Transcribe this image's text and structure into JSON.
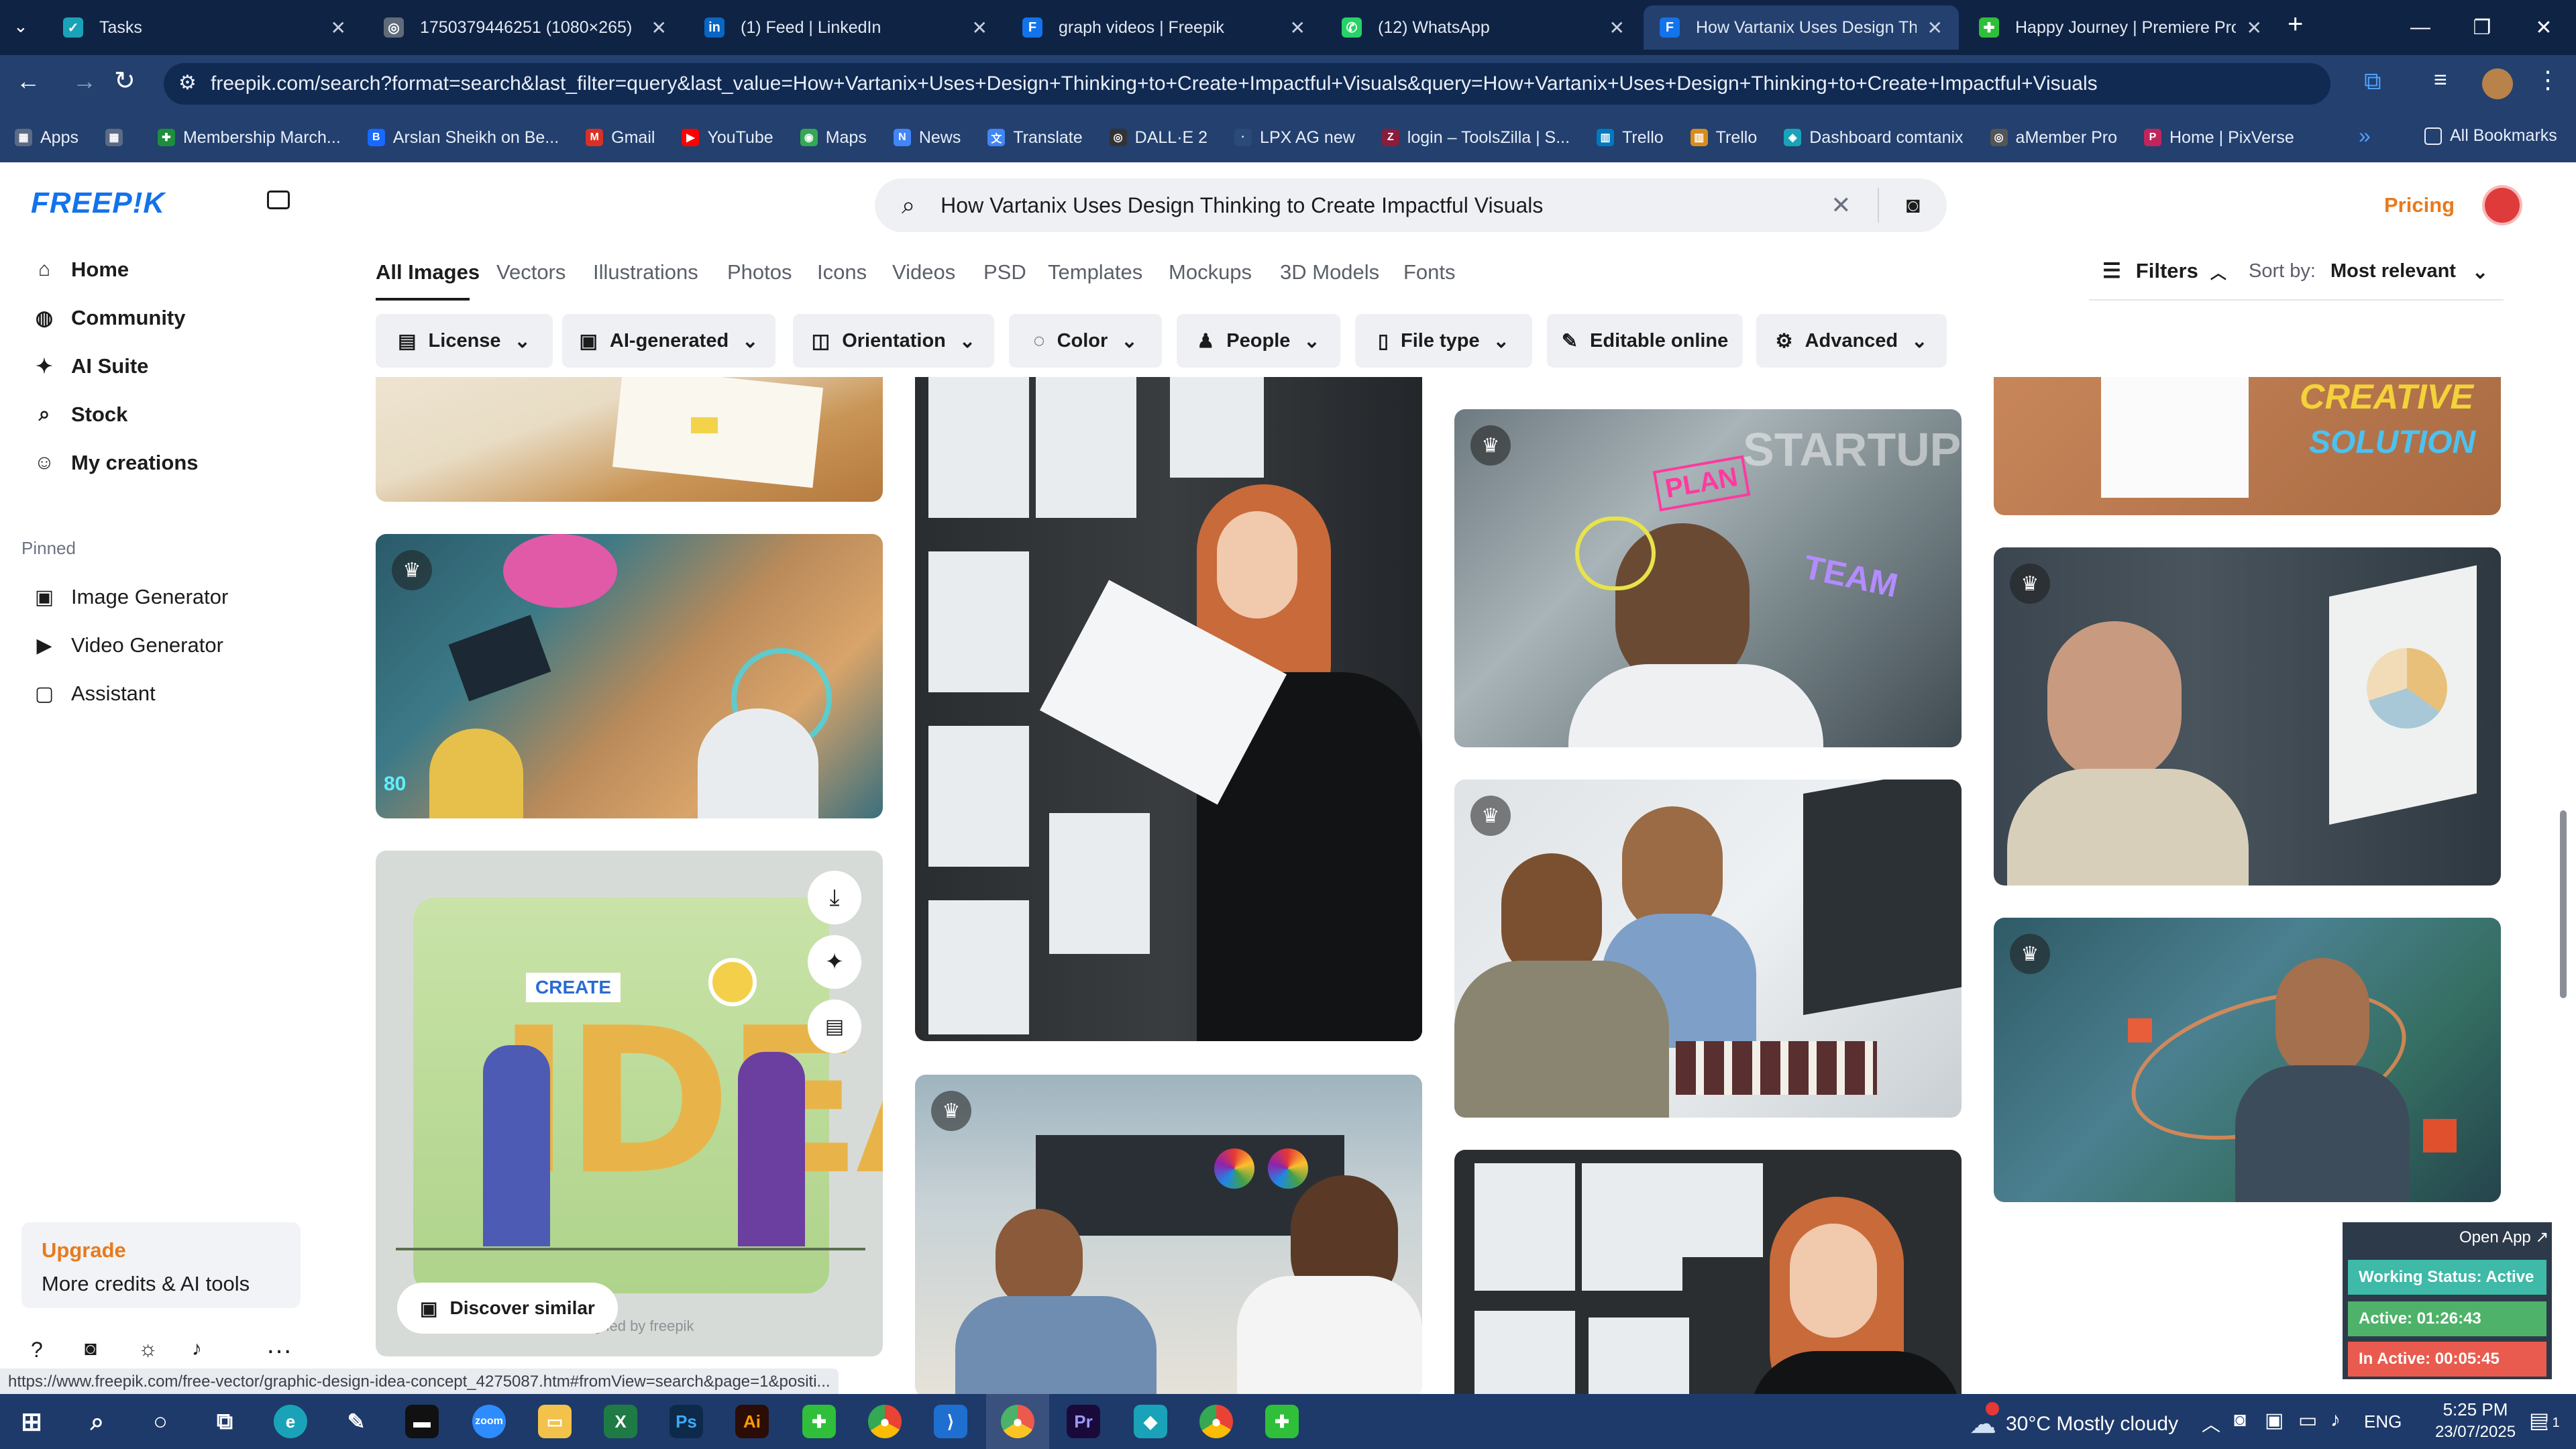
{
  "browser": {
    "tabs": [
      {
        "title": "Tasks",
        "color": "#1aa3b8",
        "glyph": "✓"
      },
      {
        "title": "1750379446251 (1080×265)",
        "color": "#5f6b7a",
        "glyph": "◎"
      },
      {
        "title": "(1) Feed | LinkedIn",
        "color": "#0a66c2",
        "glyph": "in"
      },
      {
        "title": "graph videos | Freepik",
        "color": "#1273eb",
        "glyph": "F"
      },
      {
        "title": "(12) WhatsApp",
        "color": "#25d366",
        "glyph": "✆"
      },
      {
        "title": "How Vartanix Uses Design Thin",
        "color": "#1273eb",
        "glyph": "F"
      },
      {
        "title": "Happy Journey | Premiere Pro I",
        "color": "#2fbf3a",
        "glyph": "✚"
      }
    ],
    "new_tab": "+",
    "url": "freepik.com/search?format=search&last_filter=query&last_value=How+Vartanix+Uses+Design+Thinking+to+Create+Impactful+Visuals&query=How+Vartanix+Uses+Design+Thinking+to+Create+Impactful+Visuals",
    "bookmarks": [
      {
        "label": "Apps",
        "color": "#5b6b86",
        "glyph": "▦"
      },
      {
        "label": "",
        "color": "#5b6b86",
        "glyph": "▦"
      },
      {
        "label": "Membership March...",
        "color": "#1e8e3e",
        "glyph": "✚"
      },
      {
        "label": "Arslan Sheikh on Be...",
        "color": "#1769ff",
        "glyph": "Bē"
      },
      {
        "label": "Gmail",
        "color": "#d93025",
        "glyph": "M"
      },
      {
        "label": "YouTube",
        "color": "#ff0000",
        "glyph": "▶"
      },
      {
        "label": "Maps",
        "color": "#34a853",
        "glyph": "◉"
      },
      {
        "label": "News",
        "color": "#4285f4",
        "glyph": "N"
      },
      {
        "label": "Translate",
        "color": "#4285f4",
        "glyph": "文"
      },
      {
        "label": "DALL·E 2",
        "color": "#333333",
        "glyph": "◎"
      },
      {
        "label": "LPX AG new",
        "color": "#2b4a7a",
        "glyph": "···"
      },
      {
        "label": "login – ToolsZilla | S...",
        "color": "#8a1c3c",
        "glyph": "Z"
      },
      {
        "label": "Trello",
        "color": "#0079bf",
        "glyph": "▥"
      },
      {
        "label": "Trello",
        "color": "#d98c1a",
        "glyph": "▥"
      },
      {
        "label": "Dashboard comtanix",
        "color": "#1aa3b8",
        "glyph": "◈"
      },
      {
        "label": "aMember Pro",
        "color": "#555555",
        "glyph": "◎"
      },
      {
        "label": "Home | PixVerse",
        "color": "#c2255c",
        "glyph": "P"
      }
    ],
    "all_bookmarks": "All Bookmarks"
  },
  "freepik": {
    "logo": "FREEP!K",
    "nav": [
      {
        "label": "Home",
        "icon": "home-icon",
        "glyph": "⌂"
      },
      {
        "label": "Community",
        "icon": "globe-icon",
        "glyph": "◍"
      },
      {
        "label": "AI Suite",
        "icon": "sparkle-icon",
        "glyph": "✦"
      },
      {
        "label": "Stock",
        "icon": "search-icon",
        "glyph": "⌕"
      },
      {
        "label": "My creations",
        "icon": "user-icon",
        "glyph": "☺"
      }
    ],
    "pinned_heading": "Pinned",
    "pinned": [
      {
        "label": "Image Generator",
        "icon": "image-icon",
        "glyph": "▣"
      },
      {
        "label": "Video Generator",
        "icon": "video-icon",
        "glyph": "▶"
      },
      {
        "label": "Assistant",
        "icon": "chat-icon",
        "glyph": "▢"
      }
    ],
    "upgrade": {
      "title": "Upgrade",
      "subtitle": "More credits & AI tools"
    },
    "search_query": "How Vartanix Uses Design Thinking to Create Impactful Visuals",
    "pricing": "Pricing",
    "categories": [
      "All Images",
      "Vectors",
      "Illustrations",
      "Photos",
      "Icons",
      "Videos",
      "PSD",
      "Templates",
      "Mockups",
      "3D Models",
      "Fonts"
    ],
    "filters_label": "Filters",
    "sort_label": "Sort by:",
    "sort_value": "Most relevant",
    "chips": [
      {
        "label": "License",
        "glyph": "▤"
      },
      {
        "label": "AI-generated",
        "glyph": "▣"
      },
      {
        "label": "Orientation",
        "glyph": "◫"
      },
      {
        "label": "Color",
        "glyph": "◌"
      },
      {
        "label": "People",
        "glyph": "♟"
      },
      {
        "label": "File type",
        "glyph": "▯"
      },
      {
        "label": "Editable online",
        "glyph": "✎"
      },
      {
        "label": "Advanced",
        "glyph": "⚙"
      }
    ],
    "hover_card": {
      "discover": "Discover similar",
      "watermark": "Designed by freepik"
    },
    "img_text": {
      "plan": "PLAN",
      "startup": "STARTUP",
      "team": "TEAM",
      "creative": "CREATIVE",
      "solution": "SOLUTION",
      "create": "CREATE",
      "idea": "IDEA",
      "eighty": "80"
    },
    "status_url": "https://www.freepik.com/free-vector/graphic-design-idea-concept_4275087.htm#fromView=search&page=1&positi..."
  },
  "tracker": {
    "open_app": "Open App ↗",
    "working": "Working Status: Active",
    "active": "Active: 01:26:43",
    "inactive": "In Active: 00:05:45"
  },
  "taskbar": {
    "weather": "30°C  Mostly cloudy",
    "lang": "ENG",
    "time": "5:25 PM",
    "date": "23/07/2025",
    "notif_count": "1"
  },
  "colors": {
    "accent": "#1273eb",
    "pricing": "#e87a1d",
    "upgrade": "#e87a1d"
  }
}
